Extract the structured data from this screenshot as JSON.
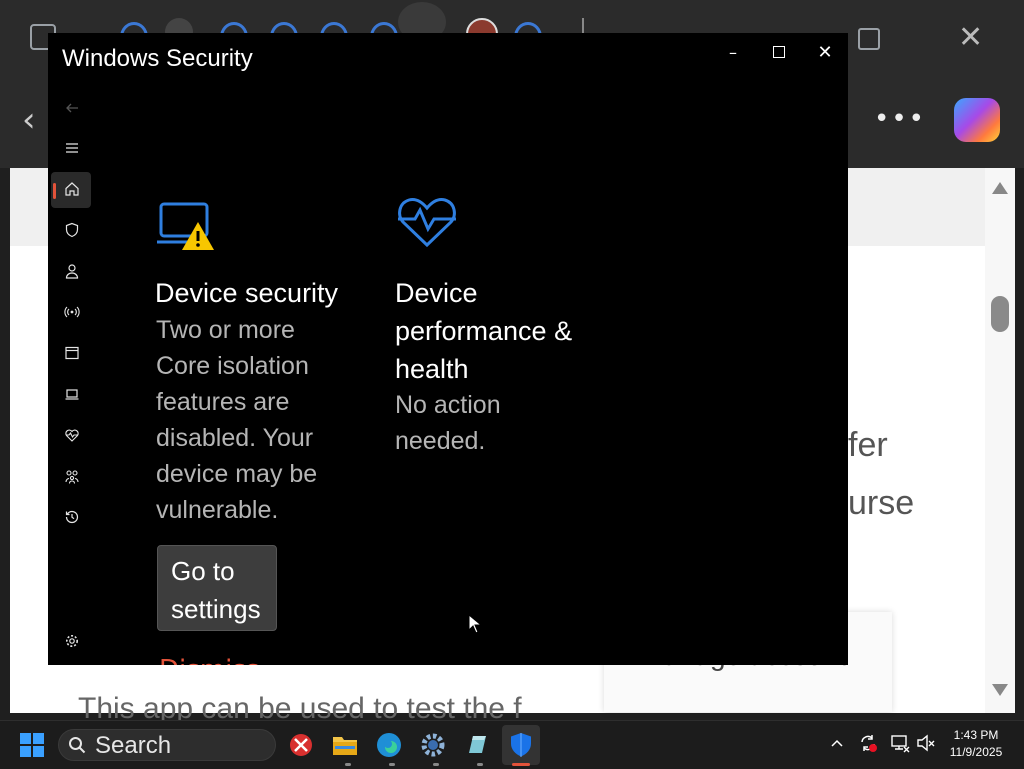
{
  "window": {
    "title": "Windows Security",
    "controls": [
      "minimize",
      "maximize",
      "close"
    ]
  },
  "nav": {
    "icons": [
      "back-arrow-icon",
      "hamburger-menu-icon",
      "home-icon",
      "shield-icon",
      "account-person-icon",
      "firewall-network-icon",
      "app-browser-control-icon",
      "device-laptop-icon",
      "heartbeat-icon",
      "family-icon",
      "history-icon",
      "gear-icon"
    ],
    "active": "home-icon"
  },
  "cards": [
    {
      "title": "Device security",
      "description": "Two or more Core isolation features are disabled.  Your device may be vulnerable.",
      "button_label": "Go to settings",
      "link_text": "Dismiss all"
    },
    {
      "title": "Device performance & health",
      "description": "No action needed."
    }
  ],
  "background_page": {
    "fragments": [
      "fer",
      "urse",
      "Manage account",
      "This app can be used to test the f"
    ]
  },
  "taskbar": {
    "search_label": "Search",
    "apps": [
      "snipping-tool-icon",
      "file-explorer-icon",
      "edge-icon",
      "settings-icon",
      "notepad-icon",
      "windows-security-icon"
    ],
    "time": "1:43 PM",
    "date": "11/9/2025"
  },
  "colors": {
    "accent_blue": "#2f7fe0",
    "warning_yellow": "#f7c600",
    "nav_active": "#e3533a"
  }
}
